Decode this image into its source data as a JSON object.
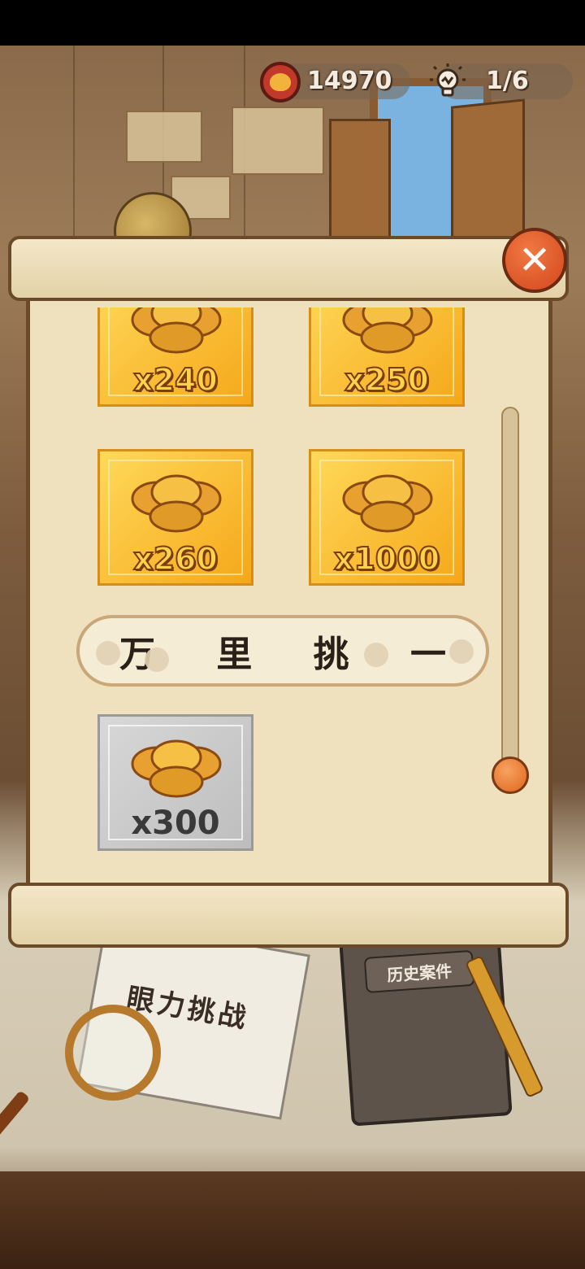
{
  "hud": {
    "coins": "14970",
    "hints": "1/6"
  },
  "panel": {
    "close_symbol": "✕",
    "rewards": [
      {
        "amount": "x240",
        "state": "gold"
      },
      {
        "amount": "x250",
        "state": "gold"
      },
      {
        "amount": "x260",
        "state": "gold"
      },
      {
        "amount": "x1000",
        "state": "gold"
      }
    ],
    "section_title": "万 里 挑 一",
    "section_rewards": [
      {
        "amount": "x300",
        "state": "grey"
      }
    ]
  },
  "desk": {
    "book_title": "眼力挑战",
    "journal_label": "历史案件"
  },
  "colors": {
    "accent_orange": "#e0661f",
    "gold_card": "#f6b52a",
    "locked_card": "#c8c8c8",
    "parchment": "#efe1bd"
  },
  "icons": [
    "coin-icon",
    "lightbulb-icon",
    "close-icon",
    "coin-stack-icon"
  ]
}
